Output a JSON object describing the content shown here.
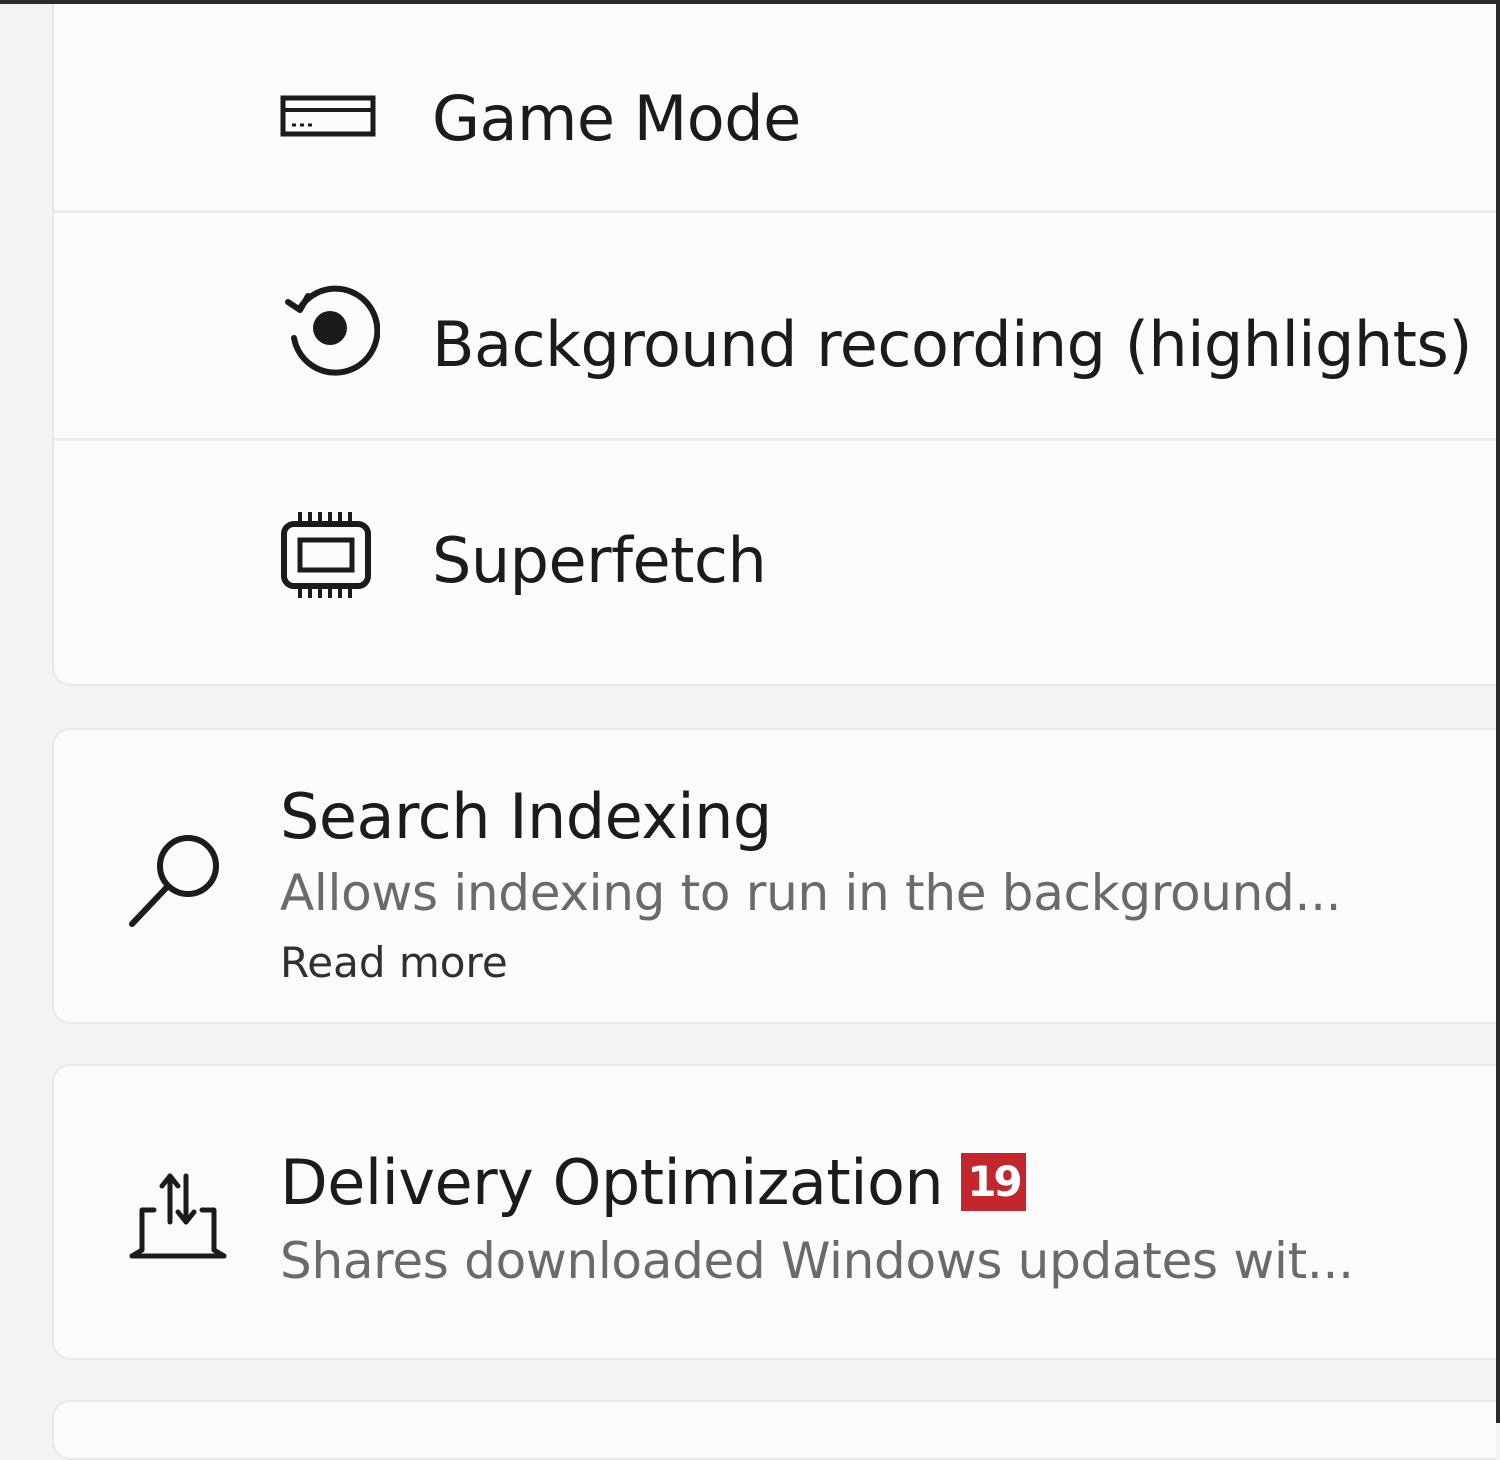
{
  "performance_group": {
    "items": [
      {
        "label": "Game Mode",
        "icon": "game-mode-icon"
      },
      {
        "label": "Background recording (highlights)",
        "icon": "record-icon"
      },
      {
        "label": "Superfetch",
        "icon": "memory-chip-icon"
      }
    ]
  },
  "search_indexing": {
    "title": "Search Indexing",
    "description": "Allows indexing to run in the background...",
    "link": "Read more",
    "icon": "search-icon"
  },
  "delivery_optimization": {
    "title": "Delivery Optimization",
    "badge": "19",
    "description": "Shares downloaded Windows updates wit...",
    "icon": "upload-download-laptop-icon",
    "badge_color": "#c4262e"
  }
}
